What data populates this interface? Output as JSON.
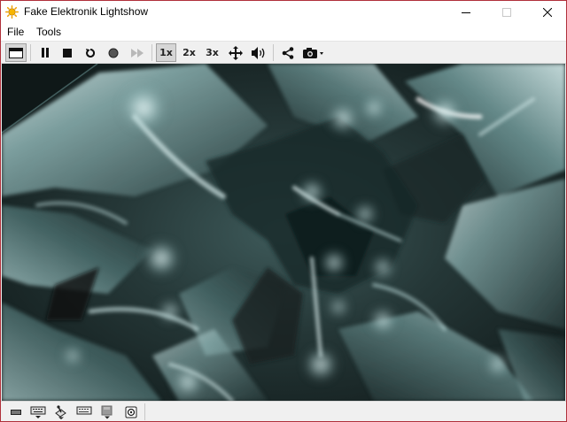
{
  "window": {
    "title": "Fake Elektronik Lightshow"
  },
  "menu": {
    "items": [
      "File",
      "Tools"
    ]
  },
  "toolbar": {
    "zoom_1x": "1x",
    "zoom_2x": "2x",
    "zoom_3x": "3x",
    "active_zoom": "1x"
  },
  "colors": {
    "accent_border": "#b0303a",
    "viewport_dark": "#1a2727",
    "viewport_light": "#bfe0e0"
  }
}
